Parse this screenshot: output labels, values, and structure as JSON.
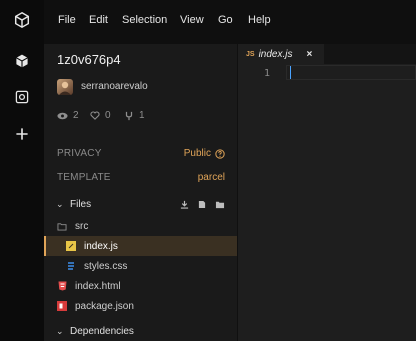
{
  "menu": [
    "File",
    "Edit",
    "Selection",
    "View",
    "Go",
    "Help"
  ],
  "activity": {
    "logo_icon": "codesandbox-cube-icon",
    "items": [
      "sandbox-info-icon",
      "devtools-panel-icon",
      "add-icon"
    ]
  },
  "sandbox": {
    "title": "1z0v676p4",
    "author": "serranoarevalo",
    "views": "2",
    "likes": "0",
    "forks": "1"
  },
  "privacy": {
    "label": "PRIVACY",
    "value": "Public"
  },
  "template": {
    "label": "TEMPLATE",
    "value": "parcel"
  },
  "files": {
    "label": "Files",
    "items": [
      {
        "name": "src",
        "type": "folder"
      },
      {
        "name": "index.js",
        "type": "js",
        "active": true
      },
      {
        "name": "styles.css",
        "type": "css"
      },
      {
        "name": "index.html",
        "type": "html"
      },
      {
        "name": "package.json",
        "type": "json"
      }
    ]
  },
  "dependencies": {
    "label": "Dependencies"
  },
  "editor": {
    "tab": {
      "lang": "JS",
      "name": "index.js",
      "close": "×"
    },
    "lines": [
      "1"
    ]
  },
  "colors": {
    "accent": "#e0a458",
    "cursor": "#4aa3ff",
    "html_icon": "#e44d4d",
    "css_icon": "#3d8eea"
  }
}
